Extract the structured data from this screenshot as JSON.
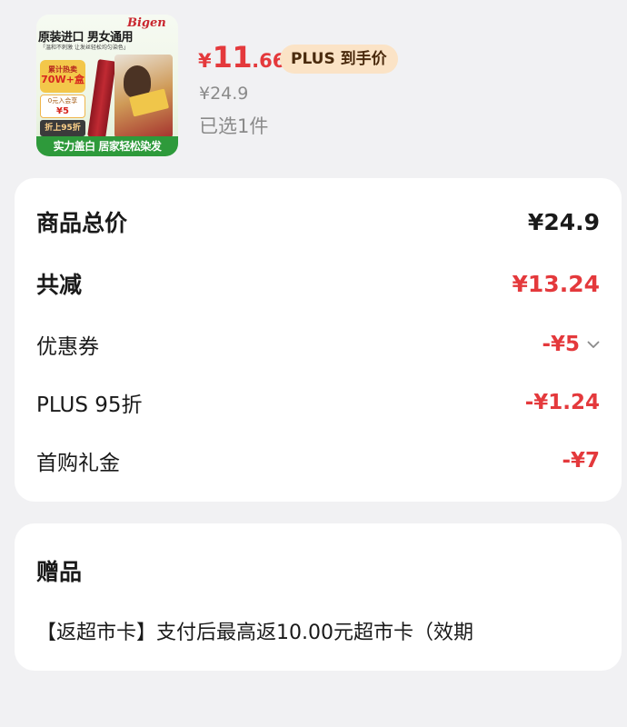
{
  "product": {
    "image": {
      "brand": "Bigen",
      "headline": "原装进口 男女通用",
      "subline": "「温和不刺激 让发丝轻松均匀染色」",
      "sold_label": "累计热卖",
      "sold_value": "70W+盒",
      "coupon_top": "0元入会享",
      "coupon_value": "¥5",
      "discount": "折上95折",
      "slogan": "实力盖白 居家轻松染发"
    },
    "price_yen": "¥",
    "price_int": "11",
    "price_dec": ".66",
    "plus_badge": "PLUS 到手价",
    "original_price": "¥24.9",
    "selected_count": "已选1件"
  },
  "summary": {
    "total_label": "商品总价",
    "total_value": "¥24.9",
    "reduced_label": "共减",
    "reduced_value": "¥13.24",
    "coupon_label": "优惠券",
    "coupon_value": "-¥5",
    "plus_label": "PLUS 95折",
    "plus_value": "-¥1.24",
    "first_gift_label": "首购礼金",
    "first_gift_value": "-¥7"
  },
  "gift": {
    "title": "赠品",
    "description": "【返超市卡】支付后最高返10.00元超市卡（效期"
  },
  "colors": {
    "accent_red": "#e4393c",
    "plus_badge_bg": "#fbe3c6",
    "page_bg": "#f1f1f3"
  }
}
